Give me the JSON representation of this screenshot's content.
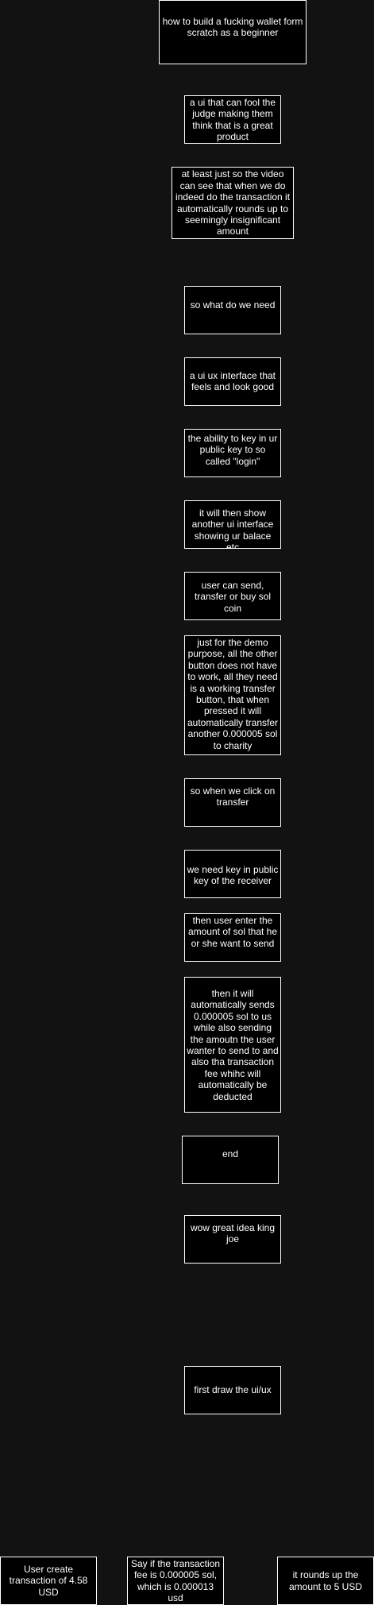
{
  "colors": {
    "background": "#121212",
    "node_fill": "#000000",
    "node_border": "#ffffff",
    "text": "#ffffff"
  },
  "nodes": [
    {
      "id": "title",
      "text": "how to build a fucking wallet form scratch as a beginner"
    },
    {
      "id": "fool-judge",
      "text": "a ui that can fool the judge making them think that is a great product"
    },
    {
      "id": "rounds-up",
      "text": "at least just so the video can see that when we do indeed do the transaction it automatically rounds up to seemingly insignificant amount"
    },
    {
      "id": "what-we-need",
      "text": "so what do we need"
    },
    {
      "id": "ui-ux",
      "text": "a ui ux interface that feels and look good"
    },
    {
      "id": "login",
      "text": "the ability to key in ur public key to so called \"login\""
    },
    {
      "id": "balance",
      "text": "it will then show another ui interface showing ur balace etc"
    },
    {
      "id": "send-transfer",
      "text": "user can send, transfer or buy sol coin"
    },
    {
      "id": "demo-purpose",
      "text": "just for the demo purpose, all the other button does not have to work, all they need is a working transfer button, that when pressed it will automatically transfer another 0.000005 sol to charity"
    },
    {
      "id": "click-transfer",
      "text": "so when we click on transfer"
    },
    {
      "id": "receiver-key",
      "text": "we need key in public key of the receiver"
    },
    {
      "id": "enter-amount",
      "text": "then user enter the amount of sol that he or she want to send"
    },
    {
      "id": "auto-send",
      "text": "then it will automatically sends 0.000005 sol to us while also sending the amoutn the user wanter to send to and also tha transaction fee whihc will automatically be deducted"
    },
    {
      "id": "end",
      "text": "end"
    },
    {
      "id": "great-idea",
      "text": "wow great idea king joe"
    },
    {
      "id": "first-draw",
      "text": "first draw the ui/ux"
    },
    {
      "id": "user-create",
      "text": "User create transaction of 4.58 USD"
    },
    {
      "id": "say-fee",
      "text": "Say if the transaction fee is 0.000005 sol, which is 0.000013 usd"
    },
    {
      "id": "rounds-five",
      "text": "it rounds up the amount to 5 USD"
    }
  ]
}
